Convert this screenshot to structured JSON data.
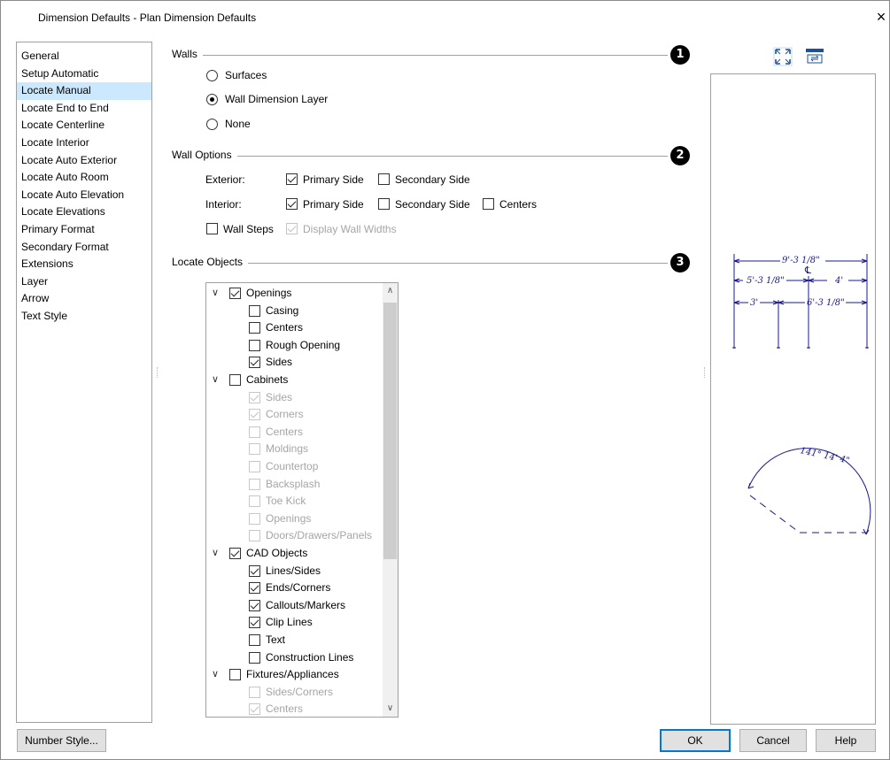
{
  "window": {
    "title": "Dimension Defaults - Plan Dimension Defaults",
    "close_glyph": "×"
  },
  "categories": [
    "General",
    "Setup Automatic",
    "Locate Manual",
    "Locate End to End",
    "Locate Centerline",
    "Locate Interior",
    "Locate Auto Exterior",
    "Locate Auto Room",
    "Locate Auto Elevation",
    "Locate Elevations",
    "Primary Format",
    "Secondary Format",
    "Extensions",
    "Layer",
    "Arrow",
    "Text Style"
  ],
  "selected_category": "Locate Manual",
  "walls": {
    "title": "Walls",
    "badge": "1",
    "options": [
      "Surfaces",
      "Wall Dimension Layer",
      "None"
    ],
    "selected": "Wall Dimension Layer"
  },
  "wall_options": {
    "title": "Wall Options",
    "badge": "2",
    "exterior_label": "Exterior:",
    "interior_label": "Interior:",
    "primary_side": "Primary Side",
    "secondary_side": "Secondary Side",
    "centers": "Centers",
    "wall_steps": "Wall Steps",
    "display_wall_widths": "Display Wall Widths",
    "exterior_primary_checked": true,
    "exterior_secondary_checked": false,
    "interior_primary_checked": true,
    "interior_secondary_checked": false,
    "interior_centers_checked": false,
    "wall_steps_checked": false,
    "display_wall_widths_checked": true
  },
  "locate_objects": {
    "title": "Locate Objects",
    "badge": "3",
    "tree": [
      {
        "label": "Openings",
        "level": 0,
        "checked": true,
        "enabled": true,
        "expanded": true
      },
      {
        "label": "Casing",
        "level": 1,
        "checked": false,
        "enabled": true
      },
      {
        "label": "Centers",
        "level": 1,
        "checked": false,
        "enabled": true
      },
      {
        "label": "Rough Opening",
        "level": 1,
        "checked": false,
        "enabled": true
      },
      {
        "label": "Sides",
        "level": 1,
        "checked": true,
        "enabled": true
      },
      {
        "label": "Cabinets",
        "level": 0,
        "checked": false,
        "enabled": true,
        "expanded": true
      },
      {
        "label": "Sides",
        "level": 1,
        "checked": true,
        "enabled": false
      },
      {
        "label": "Corners",
        "level": 1,
        "checked": true,
        "enabled": false
      },
      {
        "label": "Centers",
        "level": 1,
        "checked": false,
        "enabled": false
      },
      {
        "label": "Moldings",
        "level": 1,
        "checked": false,
        "enabled": false
      },
      {
        "label": "Countertop",
        "level": 1,
        "checked": false,
        "enabled": false
      },
      {
        "label": "Backsplash",
        "level": 1,
        "checked": false,
        "enabled": false
      },
      {
        "label": "Toe Kick",
        "level": 1,
        "checked": false,
        "enabled": false
      },
      {
        "label": "Openings",
        "level": 1,
        "checked": false,
        "enabled": false
      },
      {
        "label": "Doors/Drawers/Panels",
        "level": 1,
        "checked": false,
        "enabled": false
      },
      {
        "label": "CAD Objects",
        "level": 0,
        "checked": true,
        "enabled": true,
        "expanded": true
      },
      {
        "label": "Lines/Sides",
        "level": 1,
        "checked": true,
        "enabled": true
      },
      {
        "label": "Ends/Corners",
        "level": 1,
        "checked": true,
        "enabled": true
      },
      {
        "label": "Callouts/Markers",
        "level": 1,
        "checked": true,
        "enabled": true
      },
      {
        "label": "Clip Lines",
        "level": 1,
        "checked": true,
        "enabled": true
      },
      {
        "label": "Text",
        "level": 1,
        "checked": false,
        "enabled": true
      },
      {
        "label": "Construction Lines",
        "level": 1,
        "checked": false,
        "enabled": true
      },
      {
        "label": "Fixtures/Appliances",
        "level": 0,
        "checked": false,
        "enabled": true,
        "expanded": true
      },
      {
        "label": "Sides/Corners",
        "level": 1,
        "checked": false,
        "enabled": false
      },
      {
        "label": "Centers",
        "level": 1,
        "checked": true,
        "enabled": false
      }
    ]
  },
  "preview": {
    "dim_overall": "9'-3 1/8\"",
    "dim_left": "5'-3 1/8\"",
    "dim_right": "4'",
    "dim_bottom_left": "3'",
    "dim_bottom_right": "6'-3 1/8\"",
    "centerline_symbol": "℄",
    "angle": "141° 14' 4\"",
    "icons": [
      "fit-to-window-icon",
      "swap-view-icon"
    ]
  },
  "buttons": {
    "number_style": "Number Style...",
    "ok": "OK",
    "cancel": "Cancel",
    "help": "Help"
  },
  "colors": {
    "selection": "#cce8ff",
    "preview_ink": "#1a1a8c",
    "default_button_border": "#0078d7"
  }
}
